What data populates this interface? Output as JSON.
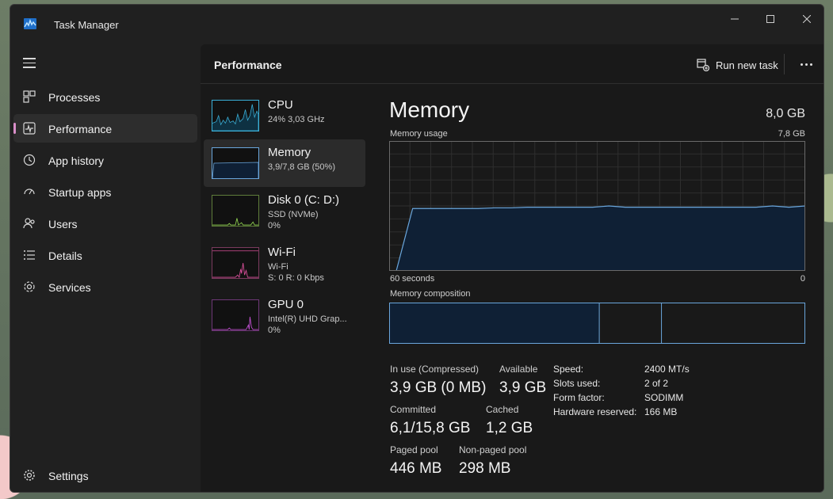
{
  "window": {
    "title": "Task Manager"
  },
  "sidebar": {
    "items": [
      {
        "label": "Processes",
        "icon": "processes-icon"
      },
      {
        "label": "Performance",
        "icon": "performance-icon",
        "active": true
      },
      {
        "label": "App history",
        "icon": "app-history-icon"
      },
      {
        "label": "Startup apps",
        "icon": "startup-apps-icon"
      },
      {
        "label": "Users",
        "icon": "users-icon"
      },
      {
        "label": "Details",
        "icon": "details-icon"
      },
      {
        "label": "Services",
        "icon": "services-icon"
      }
    ],
    "settings_label": "Settings"
  },
  "header": {
    "title": "Performance",
    "run_task_label": "Run new task"
  },
  "devices": [
    {
      "name": "CPU",
      "sub": "24%  3,03 GHz",
      "sub2": ""
    },
    {
      "name": "Memory",
      "sub": "3,9/7,8 GB (50%)",
      "sub2": ""
    },
    {
      "name": "Disk 0 (C: D:)",
      "sub": "SSD (NVMe)",
      "sub2": "0%"
    },
    {
      "name": "Wi-Fi",
      "sub": "Wi-Fi",
      "sub2": "S: 0  R: 0 Kbps"
    },
    {
      "name": "GPU 0",
      "sub": "Intel(R) UHD Grap...",
      "sub2": "0%"
    }
  ],
  "detail": {
    "title": "Memory",
    "total": "8,0 GB",
    "usage_label": "Memory usage",
    "usage_max": "7,8 GB",
    "time_left": "60 seconds",
    "time_right": "0",
    "composition_label": "Memory composition",
    "composition_fractions": {
      "in_use": 0.505,
      "modified": 0.655,
      "standby": 1.0
    },
    "usage_series": [
      0.0,
      0.48,
      0.48,
      0.48,
      0.48,
      0.48,
      0.485,
      0.485,
      0.49,
      0.49,
      0.49,
      0.49,
      0.49,
      0.5,
      0.49,
      0.49,
      0.49,
      0.49,
      0.49,
      0.49,
      0.49,
      0.49,
      0.49,
      0.5,
      0.49,
      0.5
    ],
    "stats": {
      "in_use_label": "In use (Compressed)",
      "in_use_value": "3,9 GB (0 MB)",
      "available_label": "Available",
      "available_value": "3,9 GB",
      "committed_label": "Committed",
      "committed_value": "6,1/15,8 GB",
      "cached_label": "Cached",
      "cached_value": "1,2 GB",
      "paged_label": "Paged pool",
      "paged_value": "446 MB",
      "nonpaged_label": "Non-paged pool",
      "nonpaged_value": "298 MB"
    },
    "specs": [
      {
        "key": "Speed:",
        "value": "2400 MT/s"
      },
      {
        "key": "Slots used:",
        "value": "2 of 2"
      },
      {
        "key": "Form factor:",
        "value": "SODIMM"
      },
      {
        "key": "Hardware reserved:",
        "value": "166 MB"
      }
    ]
  },
  "colors": {
    "accent": "#d98ec9",
    "memory_line": "#6aa6dc",
    "memory_fill": "#0f2035",
    "cpu": "#3bb0d8",
    "disk": "#8fd14f",
    "wifi": "#d94f9a",
    "gpu": "#c04fd0"
  }
}
